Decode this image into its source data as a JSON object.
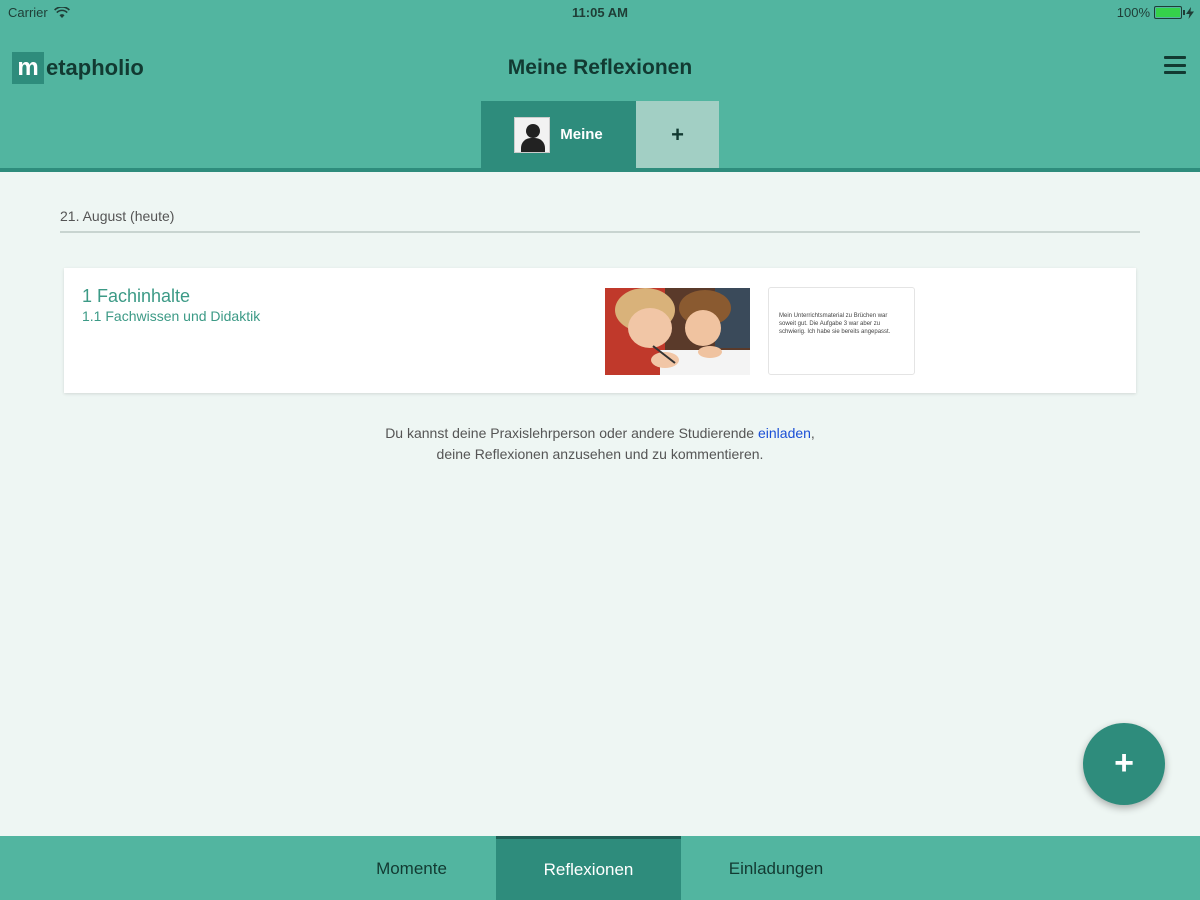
{
  "statusbar": {
    "carrier": "Carrier",
    "time": "11:05 AM",
    "battery": "100%",
    "battery_level": 1.0
  },
  "header": {
    "logo_letter": "m",
    "logo_text": "etapholio",
    "title": "Meine Reflexionen",
    "menu_icon": "hamburger-menu-icon"
  },
  "tabs": [
    {
      "label": "Meine",
      "icon": "user-avatar-icon",
      "active": true
    },
    {
      "label": "+",
      "icon": "plus-icon",
      "active": false
    }
  ],
  "content": {
    "date_label": "21. August (heute)",
    "card": {
      "title": "1 Fachinhalte",
      "subtitle": "1.1 Fachwissen und Didaktik",
      "text_preview": "Mein Unterrichtsmaterial zu Brüchen war soweit gut. Die Aufgabe 3 war aber zu schwierig. Ich habe sie bereits angepasst."
    },
    "info_prefix": "Du kannst deine Praxislehrperson oder andere Studierende ",
    "info_link": "einladen",
    "info_suffix": ",",
    "info_line2": "deine Reflexionen anzusehen und zu kommentieren."
  },
  "fab": {
    "label": "+"
  },
  "bottom_nav": {
    "items": [
      {
        "label": "Momente",
        "active": false
      },
      {
        "label": "Reflexionen",
        "active": true
      },
      {
        "label": "Einladungen",
        "active": false
      }
    ]
  },
  "colors": {
    "primary": "#52b5a0",
    "primary_dark": "#2e8c7c",
    "link": "#1a4fd6",
    "background": "#eef6f3"
  }
}
